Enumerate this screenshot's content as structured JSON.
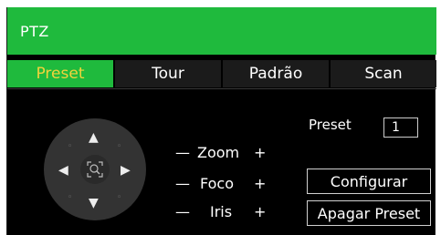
{
  "window": {
    "title": "PTZ"
  },
  "tabs": [
    {
      "label": "Preset",
      "active": true
    },
    {
      "label": "Tour",
      "active": false
    },
    {
      "label": "Padrão",
      "active": false
    },
    {
      "label": "Scan",
      "active": false
    }
  ],
  "joystick": {
    "up": "▲",
    "down": "▼",
    "left": "◀",
    "right": "▶",
    "diag": "◦"
  },
  "controls": {
    "zoom": {
      "minus": "—",
      "label": "Zoom",
      "plus": "+"
    },
    "foco": {
      "minus": "—",
      "label": "Foco",
      "plus": "+"
    },
    "iris": {
      "minus": "—",
      "label": "Iris",
      "plus": "+"
    }
  },
  "preset": {
    "label": "Preset",
    "value": "1"
  },
  "buttons": {
    "configurar": "Configurar",
    "apagar_preset": "Apagar Preset"
  },
  "colors": {
    "accent": "#1fba3d",
    "active_tab_text": "#f1d33b",
    "panel_bg": "#000000"
  }
}
